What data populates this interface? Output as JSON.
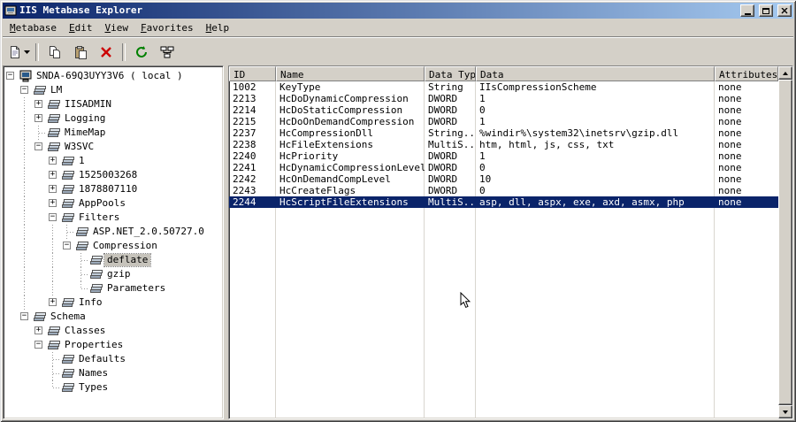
{
  "window": {
    "title": "IIS Metabase Explorer"
  },
  "menu": {
    "items": [
      "Metabase",
      "Edit",
      "View",
      "Favorites",
      "Help"
    ]
  },
  "toolbar": {
    "groups": [
      [
        {
          "name": "new-key-button",
          "icon": "new-page-icon",
          "dropdown": true
        }
      ],
      [
        {
          "name": "copy-button",
          "icon": "copy-icon"
        },
        {
          "name": "paste-button",
          "icon": "paste-icon"
        },
        {
          "name": "delete-button",
          "icon": "delete-icon"
        }
      ],
      [
        {
          "name": "refresh-button",
          "icon": "refresh-icon"
        },
        {
          "name": "connect-button",
          "icon": "network-icon"
        }
      ]
    ]
  },
  "tree": {
    "items": [
      {
        "label": "SNDA-69Q3UYY3V6 ( local )",
        "indent": 0,
        "expand": "-",
        "icon": "computer-icon"
      },
      {
        "label": "LM",
        "indent": 1,
        "expand": "-",
        "icon": "metabase-key-icon"
      },
      {
        "label": "IISADMIN",
        "indent": 2,
        "expand": "+",
        "icon": "metabase-key-icon"
      },
      {
        "label": "Logging",
        "indent": 2,
        "expand": "+",
        "icon": "metabase-key-icon"
      },
      {
        "label": "MimeMap",
        "indent": 2,
        "expand": "",
        "icon": "metabase-key-icon"
      },
      {
        "label": "W3SVC",
        "indent": 2,
        "expand": "-",
        "icon": "metabase-key-icon"
      },
      {
        "label": "1",
        "indent": 3,
        "expand": "+",
        "icon": "metabase-key-icon"
      },
      {
        "label": "1525003268",
        "indent": 3,
        "expand": "+",
        "icon": "metabase-key-icon"
      },
      {
        "label": "1878807110",
        "indent": 3,
        "expand": "+",
        "icon": "metabase-key-icon"
      },
      {
        "label": "AppPools",
        "indent": 3,
        "expand": "+",
        "icon": "metabase-key-icon"
      },
      {
        "label": "Filters",
        "indent": 3,
        "expand": "-",
        "icon": "metabase-key-icon"
      },
      {
        "label": "ASP.NET_2.0.50727.0",
        "indent": 4,
        "expand": "",
        "icon": "metabase-key-icon"
      },
      {
        "label": "Compression",
        "indent": 4,
        "expand": "-",
        "icon": "metabase-key-icon"
      },
      {
        "label": "deflate",
        "indent": 5,
        "expand": "",
        "icon": "metabase-key-icon",
        "selected": true
      },
      {
        "label": "gzip",
        "indent": 5,
        "expand": "",
        "icon": "metabase-key-icon"
      },
      {
        "label": "Parameters",
        "indent": 5,
        "expand": "",
        "icon": "metabase-key-icon"
      },
      {
        "label": "Info",
        "indent": 3,
        "expand": "+",
        "icon": "metabase-key-icon"
      },
      {
        "label": "Schema",
        "indent": 1,
        "expand": "-",
        "icon": "metabase-key-icon"
      },
      {
        "label": "Classes",
        "indent": 2,
        "expand": "+",
        "icon": "metabase-key-icon"
      },
      {
        "label": "Properties",
        "indent": 2,
        "expand": "-",
        "icon": "metabase-key-icon"
      },
      {
        "label": "Defaults",
        "indent": 3,
        "expand": "",
        "icon": "metabase-key-icon"
      },
      {
        "label": "Names",
        "indent": 3,
        "expand": "",
        "icon": "metabase-key-icon"
      },
      {
        "label": "Types",
        "indent": 3,
        "expand": "",
        "icon": "metabase-key-icon"
      }
    ]
  },
  "table": {
    "columns": [
      "ID",
      "Name",
      "Data Type",
      "Data",
      "Attributes"
    ],
    "rows": [
      {
        "id": "1002",
        "name": "KeyType",
        "type": "String",
        "data": "IIsCompressionScheme",
        "attrs": "none"
      },
      {
        "id": "2213",
        "name": "HcDoDynamicCompression",
        "type": "DWORD",
        "data": "1",
        "attrs": "none"
      },
      {
        "id": "2214",
        "name": "HcDoStaticCompression",
        "type": "DWORD",
        "data": "0",
        "attrs": "none"
      },
      {
        "id": "2215",
        "name": "HcDoOnDemandCompression",
        "type": "DWORD",
        "data": "1",
        "attrs": "none"
      },
      {
        "id": "2237",
        "name": "HcCompressionDll",
        "type": "String...",
        "data": "%windir%\\system32\\inetsrv\\gzip.dll",
        "attrs": "none"
      },
      {
        "id": "2238",
        "name": "HcFileExtensions",
        "type": "MultiS...",
        "data": "htm, html, js, css, txt",
        "attrs": "none"
      },
      {
        "id": "2240",
        "name": "HcPriority",
        "type": "DWORD",
        "data": "1",
        "attrs": "none"
      },
      {
        "id": "2241",
        "name": "HcDynamicCompressionLevel",
        "type": "DWORD",
        "data": "0",
        "attrs": "none"
      },
      {
        "id": "2242",
        "name": "HcOnDemandCompLevel",
        "type": "DWORD",
        "data": "10",
        "attrs": "none"
      },
      {
        "id": "2243",
        "name": "HcCreateFlags",
        "type": "DWORD",
        "data": "0",
        "attrs": "none"
      },
      {
        "id": "2244",
        "name": "HcScriptFileExtensions",
        "type": "MultiS...",
        "data": "asp, dll, aspx, exe, axd, asmx, php",
        "attrs": "none",
        "selected": true
      }
    ]
  },
  "colors": {
    "titlebar_left": "#0a246a",
    "titlebar_right": "#a6caf0",
    "selection": "#0a246a",
    "chrome": "#d4d0c8"
  }
}
